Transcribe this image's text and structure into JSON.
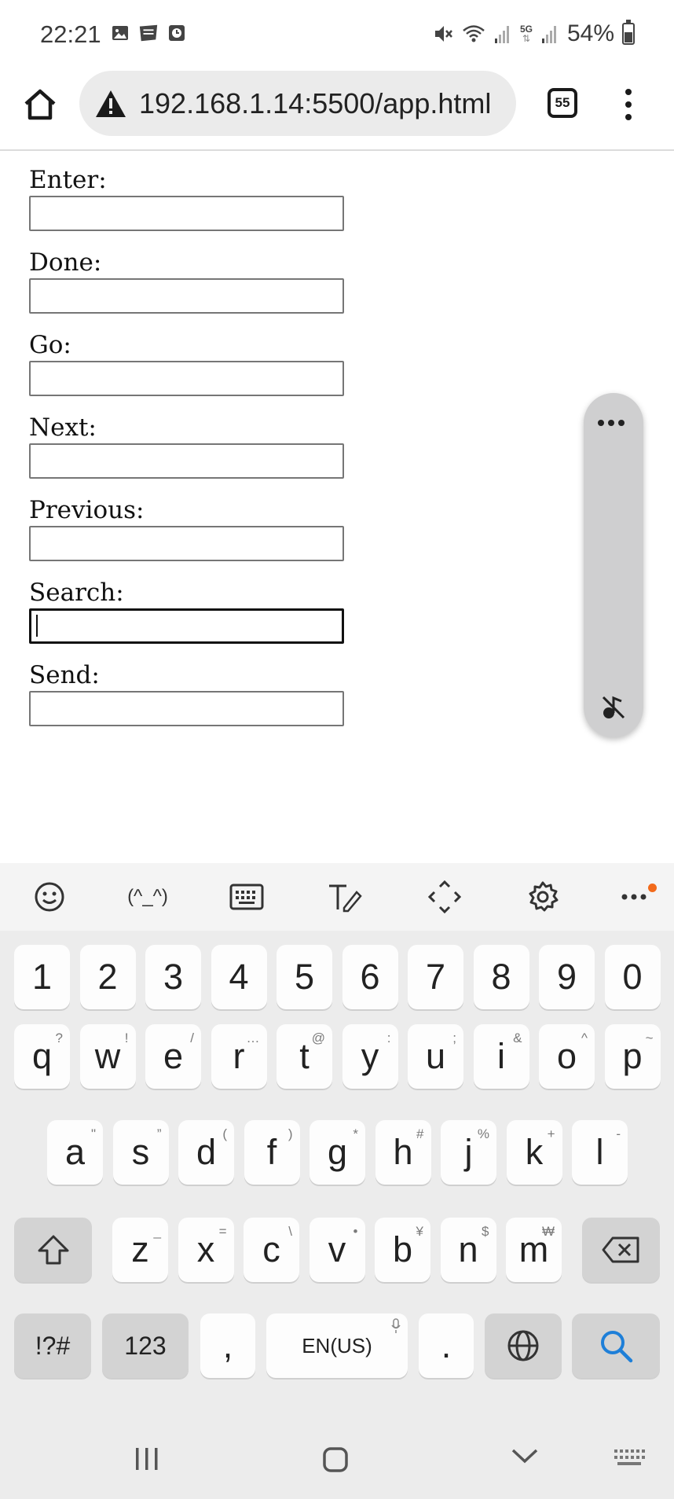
{
  "status_bar": {
    "time": "22:21",
    "left_icons": [
      "image-icon",
      "webtoon-icon",
      "clock-icon"
    ],
    "right_icons": [
      "mute-icon",
      "wifi-icon",
      "signal-icon",
      "5g-icon",
      "signal-icon"
    ],
    "network_label": "5G",
    "battery": "54%",
    "battery_level": 0.54
  },
  "browser": {
    "url": "192.168.1.14:5500/app.html",
    "tab_count": "55"
  },
  "form": {
    "fields": [
      {
        "label": "Enter:",
        "value": ""
      },
      {
        "label": "Done:",
        "value": ""
      },
      {
        "label": "Go:",
        "value": ""
      },
      {
        "label": "Next:",
        "value": ""
      },
      {
        "label": "Previous:",
        "value": ""
      },
      {
        "label": "Search:",
        "value": ""
      },
      {
        "label": "Send:",
        "value": ""
      }
    ],
    "focused_index": 5
  },
  "keyboard": {
    "toolbar_icons": [
      "emoji-icon",
      "kaomoji-icon",
      "keyboard-icon",
      "handwriting-icon",
      "cursor-move-icon",
      "settings-icon",
      "more-icon"
    ],
    "kaomoji_label": "(^_^)",
    "number_row": [
      "1",
      "2",
      "3",
      "4",
      "5",
      "6",
      "7",
      "8",
      "9",
      "0"
    ],
    "row1": [
      {
        "key": "q",
        "hint": "?"
      },
      {
        "key": "w",
        "hint": "!"
      },
      {
        "key": "e",
        "hint": "/"
      },
      {
        "key": "r",
        "hint": "…"
      },
      {
        "key": "t",
        "hint": "@"
      },
      {
        "key": "y",
        "hint": ":"
      },
      {
        "key": "u",
        "hint": ";"
      },
      {
        "key": "i",
        "hint": "&"
      },
      {
        "key": "o",
        "hint": "^"
      },
      {
        "key": "p",
        "hint": "~"
      }
    ],
    "row2": [
      {
        "key": "a",
        "hint": "\""
      },
      {
        "key": "s",
        "hint": "”"
      },
      {
        "key": "d",
        "hint": "("
      },
      {
        "key": "f",
        "hint": ")"
      },
      {
        "key": "g",
        "hint": "*"
      },
      {
        "key": "h",
        "hint": "#"
      },
      {
        "key": "j",
        "hint": "%"
      },
      {
        "key": "k",
        "hint": "+"
      },
      {
        "key": "l",
        "hint": "-"
      }
    ],
    "row3": [
      {
        "key": "z",
        "hint": "_"
      },
      {
        "key": "x",
        "hint": "="
      },
      {
        "key": "c",
        "hint": "\\"
      },
      {
        "key": "v",
        "hint": "•"
      },
      {
        "key": "b",
        "hint": "¥"
      },
      {
        "key": "n",
        "hint": "$"
      },
      {
        "key": "m",
        "hint": "₩"
      }
    ],
    "symbols_label": "!?#",
    "numbers_label": "123",
    "comma": ",",
    "space_label": "EN(US)",
    "period": ".",
    "search_color": "#1e7fd8"
  },
  "nav_bar": {
    "icons": [
      "recents-icon",
      "home-icon",
      "back-icon",
      "keyboard-switch-icon"
    ]
  }
}
